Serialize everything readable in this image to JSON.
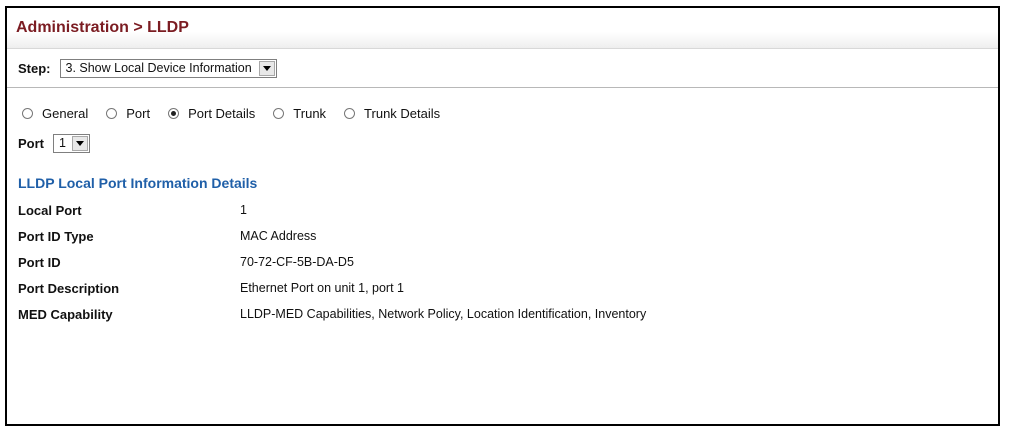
{
  "header": {
    "title": "Administration > LLDP"
  },
  "step": {
    "label": "Step:",
    "selected": "3. Show Local Device Information"
  },
  "view_options": [
    {
      "label": "General",
      "selected": false
    },
    {
      "label": "Port",
      "selected": false
    },
    {
      "label": "Port Details",
      "selected": true
    },
    {
      "label": "Trunk",
      "selected": false
    },
    {
      "label": "Trunk Details",
      "selected": false
    }
  ],
  "port": {
    "label": "Port",
    "selected": "1"
  },
  "section": {
    "title": "LLDP Local Port Information Details"
  },
  "details": [
    {
      "key": "Local Port",
      "value": "1"
    },
    {
      "key": "Port ID Type",
      "value": "MAC Address"
    },
    {
      "key": "Port ID",
      "value": "70-72-CF-5B-DA-D5"
    },
    {
      "key": "Port Description",
      "value": "Ethernet Port on unit 1, port 1"
    },
    {
      "key": "MED Capability",
      "value": "LLDP-MED Capabilities, Network Policy, Location Identification, Inventory"
    }
  ]
}
